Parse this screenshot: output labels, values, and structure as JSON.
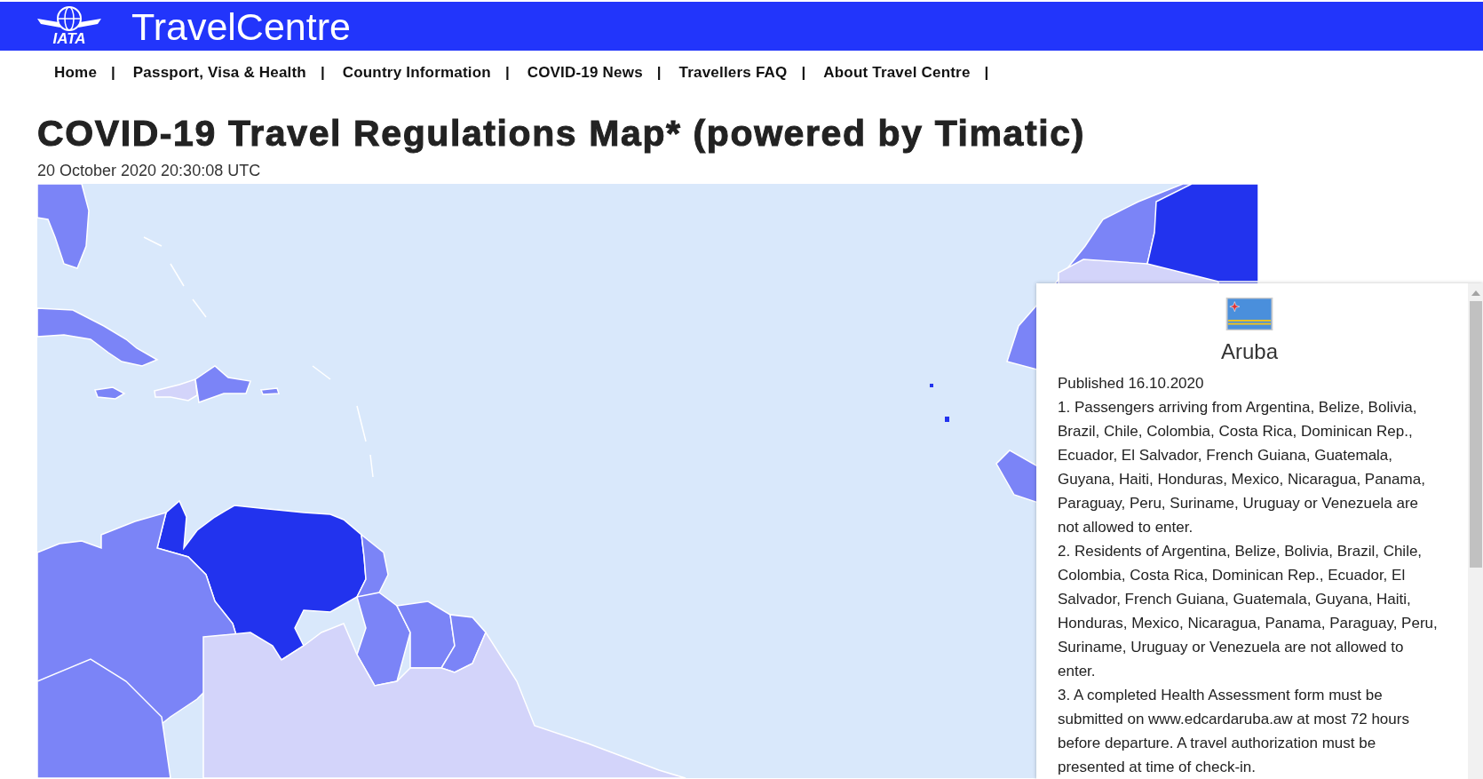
{
  "header": {
    "logo_text": "IATA",
    "brand": "TravelCentre"
  },
  "nav": [
    {
      "label": "Home",
      "separator": "|"
    },
    {
      "label": "Passport, Visa & Health",
      "separator": "|"
    },
    {
      "label": "Country Information",
      "separator": "|"
    },
    {
      "label": "COVID-19 News",
      "separator": "|"
    },
    {
      "label": "Travellers FAQ",
      "separator": "|"
    },
    {
      "label": "About Travel Centre",
      "separator": "|"
    }
  ],
  "title": "COVID-19 Travel Regulations Map* (powered by Timatic)",
  "timestamp": "20 October 2020 20:30:08 UTC",
  "popup": {
    "country": "Aruba",
    "published": "Published 16.10.2020",
    "paragraphs": [
      "1. Passengers arriving from Argentina, Belize, Bolivia, Brazil, Chile, Colombia, Costa Rica, Dominican Rep., Ecuador, El Salvador, French Guiana, Guatemala, Guyana, Haiti, Honduras, Mexico, Nicaragua, Panama, Paraguay, Peru, Suriname, Uruguay or Venezuela are not allowed to enter.",
      "2. Residents of Argentina, Belize, Bolivia, Brazil, Chile, Colombia, Costa Rica, Dominican Rep., Ecuador, El Salvador, French Guiana, Guatemala, Guyana, Haiti, Honduras, Mexico, Nicaragua, Panama, Paraguay, Peru, Suriname, Uruguay or Venezuela are not allowed to enter.",
      "3. A completed Health Assessment form must be submitted on www.edcardaruba.aw at most 72 hours before departure. A travel authorization must be presented at time of check-in."
    ]
  }
}
